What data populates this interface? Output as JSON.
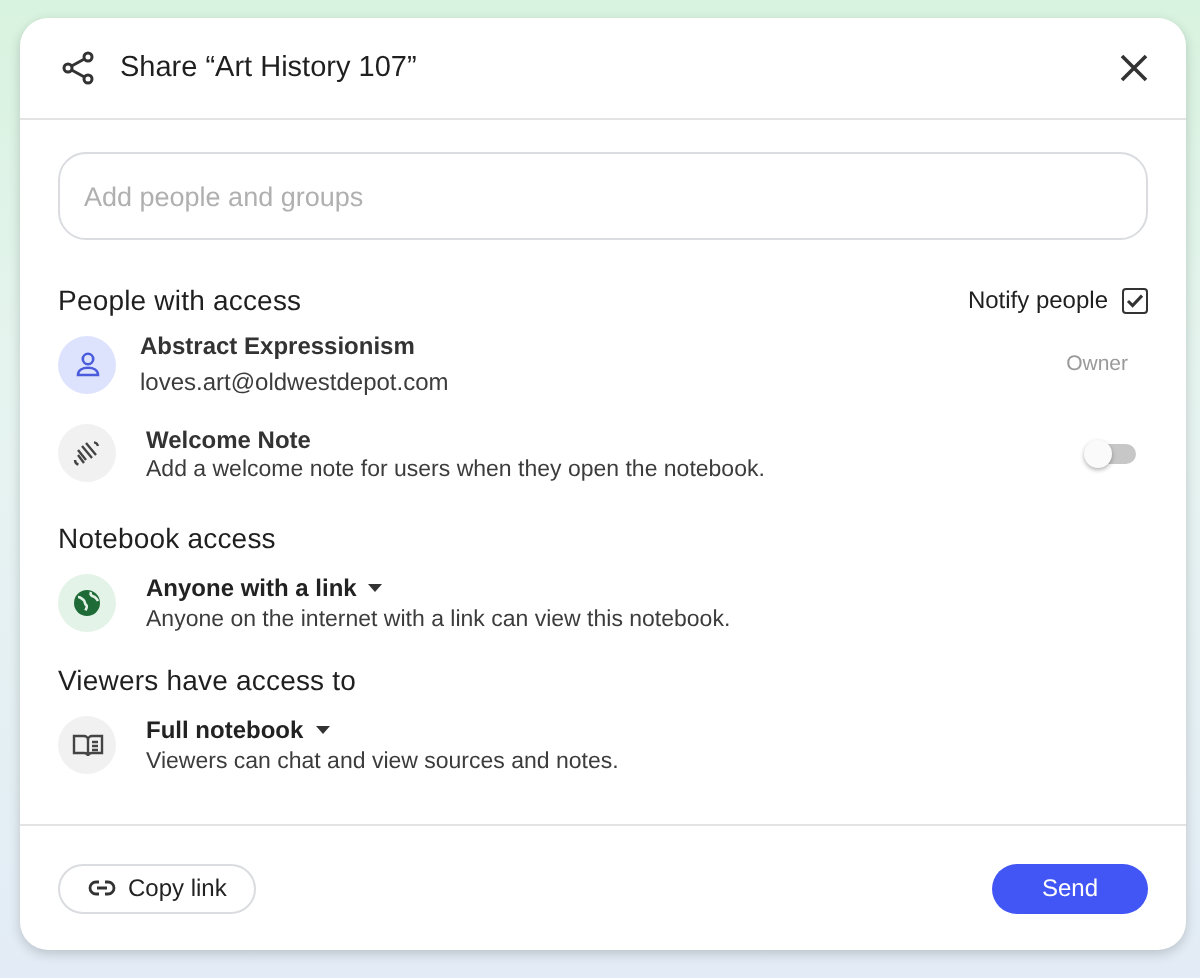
{
  "dialog": {
    "title": "Share “Art History 107”"
  },
  "search": {
    "placeholder": "Add people and groups"
  },
  "people_section": {
    "heading": "People with access",
    "notify": {
      "label": "Notify people",
      "checked": true
    }
  },
  "people": [
    {
      "name": "Abstract Expressionism",
      "email": "loves.art@oldwestdepot.com",
      "role": "Owner"
    }
  ],
  "welcome_note": {
    "title": "Welcome Note",
    "description": "Add a welcome note for users when they open the notebook.",
    "on": false
  },
  "notebook_access": {
    "heading": "Notebook access",
    "option": "Anyone with a link",
    "description": "Anyone on the internet with a link can view this notebook."
  },
  "viewer_access": {
    "heading": "Viewers have access to",
    "option": "Full notebook",
    "description": "Viewers can chat and view sources and notes."
  },
  "footer": {
    "copy_link": "Copy link",
    "send": "Send"
  }
}
